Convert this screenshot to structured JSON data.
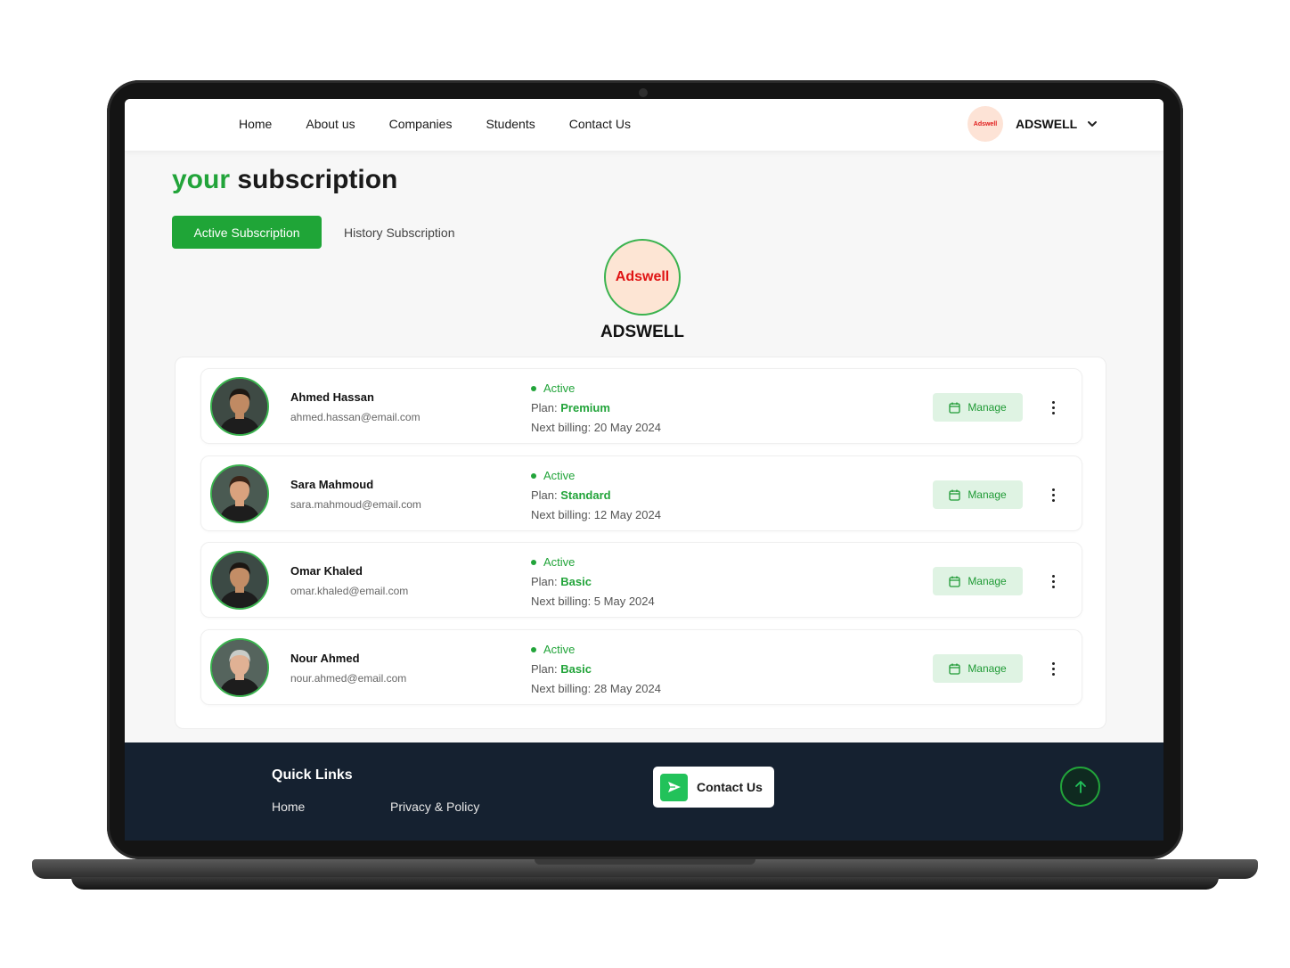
{
  "nav": {
    "links": [
      "Home",
      "About us",
      "Companies",
      "Students",
      "Contact Us"
    ],
    "user_logo_text": "Adswell",
    "username": "ADSWELL"
  },
  "page": {
    "title_accent": "your",
    "title_rest": "subscription"
  },
  "tabs": {
    "active": "Active Subscription",
    "history": "History Subscription"
  },
  "company": {
    "logo_text": "Adswell",
    "name": "ADSWELL"
  },
  "subscriptions": [
    {
      "name": "Ahmed Hassan",
      "email": "ahmed.hassan@email.com",
      "status": "Active",
      "plan_label": "Plan:",
      "plan": "Premium",
      "billing": "Next billing: 20 May 2024",
      "manage": "Manage",
      "avatar_skin": "#c08a63",
      "avatar_hair": "#1e1813",
      "avatar_bg": "#3e4a44"
    },
    {
      "name": "Sara Mahmoud",
      "email": "sara.mahmoud@email.com",
      "status": "Active",
      "plan_label": "Plan:",
      "plan": "Standard",
      "billing": "Next billing: 12 May 2024",
      "manage": "Manage",
      "avatar_skin": "#d9a27e",
      "avatar_hair": "#3a2418",
      "avatar_bg": "#4a5a52"
    },
    {
      "name": "Omar Khaled",
      "email": "omar.khaled@email.com",
      "status": "Active",
      "plan_label": "Plan:",
      "plan": "Basic",
      "billing": "Next billing: 5 May 2024",
      "manage": "Manage",
      "avatar_skin": "#c38d66",
      "avatar_hair": "#1b1612",
      "avatar_bg": "#3c4a45"
    },
    {
      "name": "Nour Ahmed",
      "email": "nour.ahmed@email.com",
      "status": "Active",
      "plan_label": "Plan:",
      "plan": "Basic",
      "billing": "Next billing: 28 May 2024",
      "manage": "Manage",
      "avatar_skin": "#e0b194",
      "avatar_hair": "#c9ccc8",
      "avatar_bg": "#55645d"
    }
  ],
  "footer": {
    "quick_links_title": "Quick Links",
    "home": "Home",
    "privacy": "Privacy & Policy",
    "contact": "Contact Us"
  },
  "colors": {
    "accent": "#22a43a",
    "footer_bg": "#152130",
    "logo_red": "#e01414"
  },
  "icons": {
    "nav_chevron": "chevron-down-icon",
    "manage": "calendar-icon",
    "more": "more-vertical-icon",
    "contact": "send-icon",
    "scroll_top": "arrow-up-icon"
  }
}
